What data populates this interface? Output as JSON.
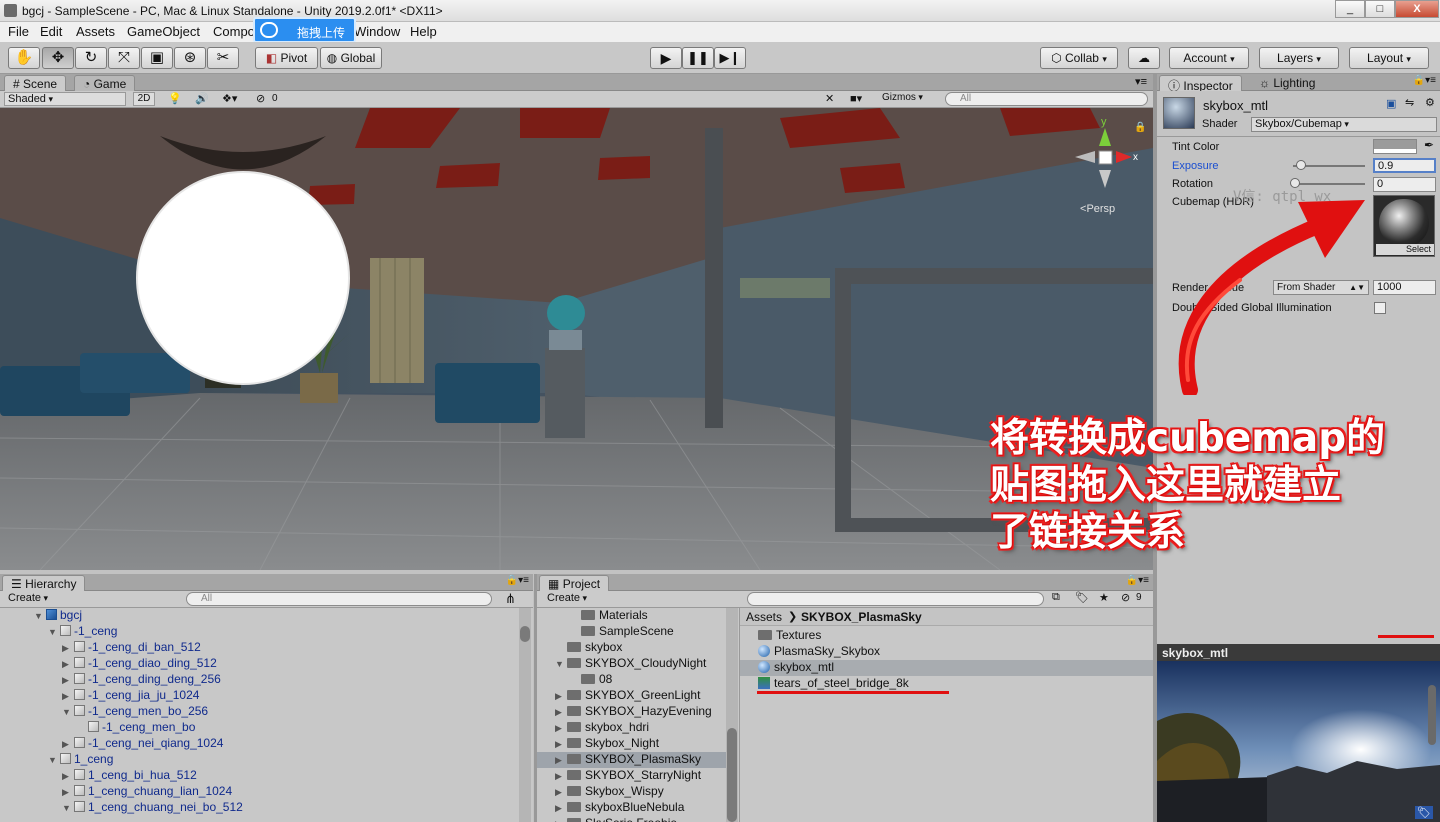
{
  "window": {
    "title": "bgcj - SampleScene - PC, Mac & Linux Standalone - Unity 2019.2.0f1* <DX11>",
    "min": "_",
    "max": "□",
    "close": "X"
  },
  "menu": [
    "File",
    "Edit",
    "Assets",
    "GameObject",
    "Compo",
    "Window",
    "Help"
  ],
  "overlay_badge": "拖拽上传",
  "toolbar": {
    "pivot": "Pivot",
    "global": "Global",
    "collab": "Collab",
    "account": "Account",
    "layers": "Layers",
    "layout": "Layout"
  },
  "scene_panel": {
    "tabs": [
      "Scene",
      "Game"
    ],
    "shading": "Shaded",
    "mode_2d": "2D",
    "hidden_count": "0",
    "gizmos": "Gizmos",
    "search_placeholder": "All",
    "axis_y": "y",
    "axis_x": "x",
    "persp": "Persp"
  },
  "hierarchy": {
    "tab": "Hierarchy",
    "create": "Create",
    "search_placeholder": "All",
    "rows": [
      {
        "text": "bgcj",
        "depth": 0,
        "open": true,
        "icon": "unity"
      },
      {
        "text": "-1_ceng",
        "depth": 1,
        "open": true,
        "icon": "cube"
      },
      {
        "text": "-1_ceng_di_ban_512",
        "depth": 2,
        "open": false,
        "icon": "cube"
      },
      {
        "text": "-1_ceng_diao_ding_512",
        "depth": 2,
        "open": false,
        "icon": "cube"
      },
      {
        "text": "-1_ceng_ding_deng_256",
        "depth": 2,
        "open": false,
        "icon": "cube"
      },
      {
        "text": "-1_ceng_jia_ju_1024",
        "depth": 2,
        "open": false,
        "icon": "cube"
      },
      {
        "text": "-1_ceng_men_bo_256",
        "depth": 2,
        "open": true,
        "icon": "cube"
      },
      {
        "text": "-1_ceng_men_bo",
        "depth": 3,
        "open": null,
        "icon": "cube"
      },
      {
        "text": "-1_ceng_nei_qiang_1024",
        "depth": 2,
        "open": false,
        "icon": "cube"
      },
      {
        "text": "1_ceng",
        "depth": 1,
        "open": true,
        "icon": "cube"
      },
      {
        "text": "1_ceng_bi_hua_512",
        "depth": 2,
        "open": false,
        "icon": "cube"
      },
      {
        "text": "1_ceng_chuang_lian_1024",
        "depth": 2,
        "open": false,
        "icon": "cube"
      },
      {
        "text": "1_ceng_chuang_nei_bo_512",
        "depth": 2,
        "open": true,
        "icon": "cube"
      }
    ]
  },
  "project": {
    "tab": "Project",
    "create": "Create",
    "filter_count": "9",
    "folders": [
      {
        "text": "Materials",
        "depth": 2,
        "arrow": ""
      },
      {
        "text": "SampleScene",
        "depth": 2,
        "arrow": ""
      },
      {
        "text": "skybox",
        "depth": 1,
        "arrow": ""
      },
      {
        "text": "SKYBOX_CloudyNight",
        "depth": 1,
        "arrow": "open"
      },
      {
        "text": "08",
        "depth": 2,
        "arrow": ""
      },
      {
        "text": "SKYBOX_GreenLight",
        "depth": 1,
        "arrow": "closed"
      },
      {
        "text": "SKYBOX_HazyEvening",
        "depth": 1,
        "arrow": "closed"
      },
      {
        "text": "skybox_hdri",
        "depth": 1,
        "arrow": "closed"
      },
      {
        "text": "Skybox_Night",
        "depth": 1,
        "arrow": "closed"
      },
      {
        "text": "SKYBOX_PlasmaSky",
        "depth": 1,
        "arrow": "closed",
        "selected": true
      },
      {
        "text": "SKYBOX_StarryNight",
        "depth": 1,
        "arrow": "closed"
      },
      {
        "text": "Skybox_Wispy",
        "depth": 1,
        "arrow": "closed"
      },
      {
        "text": "skyboxBlueNebula",
        "depth": 1,
        "arrow": "closed"
      },
      {
        "text": "SkySerie Freebie",
        "depth": 1,
        "arrow": "closed"
      }
    ],
    "breadcrumb_root": "Assets",
    "breadcrumb_current": "SKYBOX_PlasmaSky",
    "assets": [
      {
        "text": "Textures",
        "icon": "folder"
      },
      {
        "text": "PlasmaSky_Skybox",
        "icon": "material"
      },
      {
        "text": "skybox_mtl",
        "icon": "material",
        "selected": true
      },
      {
        "text": "tears_of_steel_bridge_8k",
        "icon": "texture"
      }
    ]
  },
  "inspector": {
    "tabs": [
      "Inspector",
      "Lighting"
    ],
    "material_name": "skybox_mtl",
    "shader_label": "Shader",
    "shader_value": "Skybox/Cubemap",
    "tint_label": "Tint Color",
    "exposure_label": "Exposure",
    "exposure_value": "0.9",
    "exposure": 0.9,
    "rotation_label": "Rotation",
    "rotation_value": "0",
    "cubemap_label": "Cubemap   (HDR)",
    "select_label": "Select",
    "render_queue_label": "Render Queue",
    "render_queue_mode": "From Shader",
    "render_queue_value": "1000",
    "dsgi_label": "Double Sided Global Illumination",
    "watermark": "V信: qtpl_wx"
  },
  "preview": {
    "title": "skybox_mtl"
  },
  "annotation": {
    "line1": "将转换成cubemap的",
    "line2": "贴图拖入这里就建立",
    "line3": "了链接关系",
    "color": "#e01010"
  }
}
